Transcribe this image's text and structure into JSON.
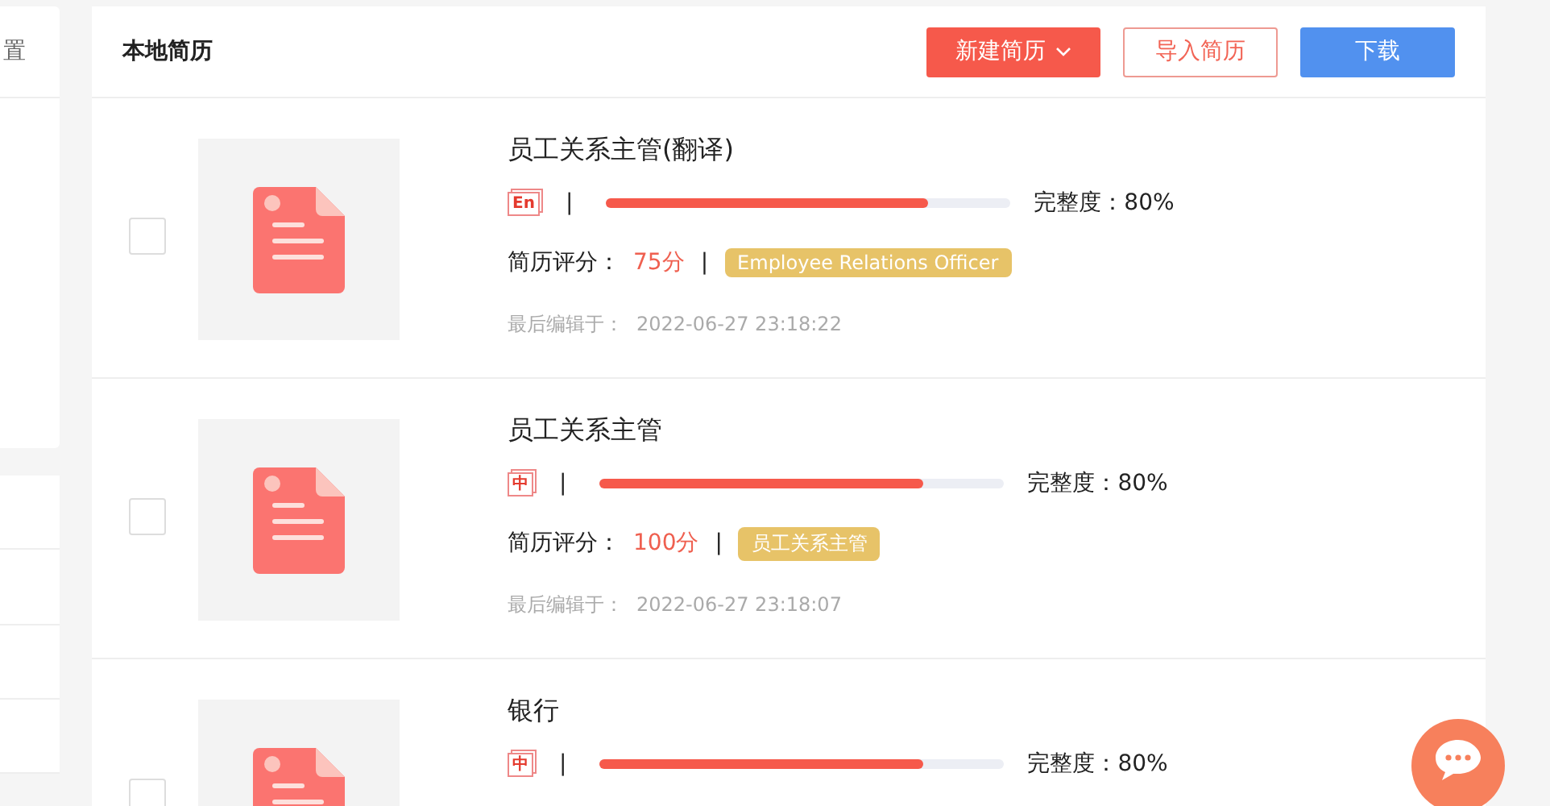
{
  "sidebar": {
    "top_label": "置"
  },
  "header": {
    "title": "本地简历",
    "buttons": [
      {
        "kind": "primary",
        "label": "新建简历",
        "dropdown": true
      },
      {
        "kind": "outline",
        "label": "导入简历",
        "dropdown": false
      },
      {
        "kind": "blue",
        "label": "下载",
        "dropdown": false
      }
    ]
  },
  "resumes": [
    {
      "title": "员工关系主管(翻译)",
      "checked": false,
      "lang": "En",
      "level": 0.8,
      "completeness_label": "完整度：",
      "completeness": "80%",
      "score_label": "简历评分：",
      "score": "75分",
      "tag": "Employee Relations Officer",
      "date_label": "最后编辑于：",
      "date": "2022-06-27 23:18:22"
    },
    {
      "title": "员工关系主管",
      "checked": false,
      "lang": "中",
      "level": 0.8,
      "completeness_label": "完整度：",
      "completeness": "80%",
      "score_label": "简历评分：",
      "score": "100分",
      "tag": "员工关系主管",
      "date_label": "最后编辑于：",
      "date": "2022-06-27 23:18:07"
    },
    {
      "title": "银行",
      "checked": false,
      "lang": "中",
      "level": 0.8,
      "completeness_label": "完整度：",
      "completeness": "80%"
    }
  ],
  "separator": "|"
}
